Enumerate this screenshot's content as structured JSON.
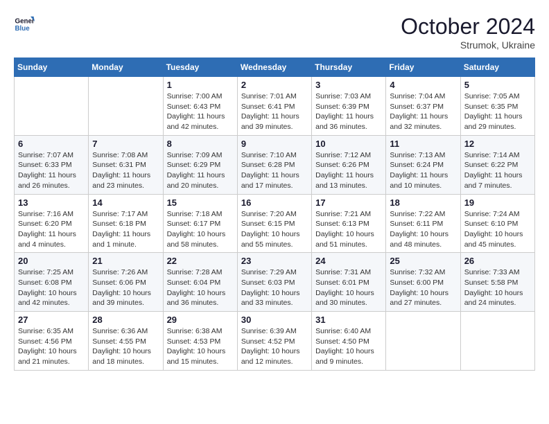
{
  "header": {
    "logo_line1": "General",
    "logo_line2": "Blue",
    "month": "October 2024",
    "location": "Strumok, Ukraine"
  },
  "weekdays": [
    "Sunday",
    "Monday",
    "Tuesday",
    "Wednesday",
    "Thursday",
    "Friday",
    "Saturday"
  ],
  "weeks": [
    [
      {
        "day": "",
        "info": ""
      },
      {
        "day": "",
        "info": ""
      },
      {
        "day": "1",
        "info": "Sunrise: 7:00 AM\nSunset: 6:43 PM\nDaylight: 11 hours and 42 minutes."
      },
      {
        "day": "2",
        "info": "Sunrise: 7:01 AM\nSunset: 6:41 PM\nDaylight: 11 hours and 39 minutes."
      },
      {
        "day": "3",
        "info": "Sunrise: 7:03 AM\nSunset: 6:39 PM\nDaylight: 11 hours and 36 minutes."
      },
      {
        "day": "4",
        "info": "Sunrise: 7:04 AM\nSunset: 6:37 PM\nDaylight: 11 hours and 32 minutes."
      },
      {
        "day": "5",
        "info": "Sunrise: 7:05 AM\nSunset: 6:35 PM\nDaylight: 11 hours and 29 minutes."
      }
    ],
    [
      {
        "day": "6",
        "info": "Sunrise: 7:07 AM\nSunset: 6:33 PM\nDaylight: 11 hours and 26 minutes."
      },
      {
        "day": "7",
        "info": "Sunrise: 7:08 AM\nSunset: 6:31 PM\nDaylight: 11 hours and 23 minutes."
      },
      {
        "day": "8",
        "info": "Sunrise: 7:09 AM\nSunset: 6:29 PM\nDaylight: 11 hours and 20 minutes."
      },
      {
        "day": "9",
        "info": "Sunrise: 7:10 AM\nSunset: 6:28 PM\nDaylight: 11 hours and 17 minutes."
      },
      {
        "day": "10",
        "info": "Sunrise: 7:12 AM\nSunset: 6:26 PM\nDaylight: 11 hours and 13 minutes."
      },
      {
        "day": "11",
        "info": "Sunrise: 7:13 AM\nSunset: 6:24 PM\nDaylight: 11 hours and 10 minutes."
      },
      {
        "day": "12",
        "info": "Sunrise: 7:14 AM\nSunset: 6:22 PM\nDaylight: 11 hours and 7 minutes."
      }
    ],
    [
      {
        "day": "13",
        "info": "Sunrise: 7:16 AM\nSunset: 6:20 PM\nDaylight: 11 hours and 4 minutes."
      },
      {
        "day": "14",
        "info": "Sunrise: 7:17 AM\nSunset: 6:18 PM\nDaylight: 11 hours and 1 minute."
      },
      {
        "day": "15",
        "info": "Sunrise: 7:18 AM\nSunset: 6:17 PM\nDaylight: 10 hours and 58 minutes."
      },
      {
        "day": "16",
        "info": "Sunrise: 7:20 AM\nSunset: 6:15 PM\nDaylight: 10 hours and 55 minutes."
      },
      {
        "day": "17",
        "info": "Sunrise: 7:21 AM\nSunset: 6:13 PM\nDaylight: 10 hours and 51 minutes."
      },
      {
        "day": "18",
        "info": "Sunrise: 7:22 AM\nSunset: 6:11 PM\nDaylight: 10 hours and 48 minutes."
      },
      {
        "day": "19",
        "info": "Sunrise: 7:24 AM\nSunset: 6:10 PM\nDaylight: 10 hours and 45 minutes."
      }
    ],
    [
      {
        "day": "20",
        "info": "Sunrise: 7:25 AM\nSunset: 6:08 PM\nDaylight: 10 hours and 42 minutes."
      },
      {
        "day": "21",
        "info": "Sunrise: 7:26 AM\nSunset: 6:06 PM\nDaylight: 10 hours and 39 minutes."
      },
      {
        "day": "22",
        "info": "Sunrise: 7:28 AM\nSunset: 6:04 PM\nDaylight: 10 hours and 36 minutes."
      },
      {
        "day": "23",
        "info": "Sunrise: 7:29 AM\nSunset: 6:03 PM\nDaylight: 10 hours and 33 minutes."
      },
      {
        "day": "24",
        "info": "Sunrise: 7:31 AM\nSunset: 6:01 PM\nDaylight: 10 hours and 30 minutes."
      },
      {
        "day": "25",
        "info": "Sunrise: 7:32 AM\nSunset: 6:00 PM\nDaylight: 10 hours and 27 minutes."
      },
      {
        "day": "26",
        "info": "Sunrise: 7:33 AM\nSunset: 5:58 PM\nDaylight: 10 hours and 24 minutes."
      }
    ],
    [
      {
        "day": "27",
        "info": "Sunrise: 6:35 AM\nSunset: 4:56 PM\nDaylight: 10 hours and 21 minutes."
      },
      {
        "day": "28",
        "info": "Sunrise: 6:36 AM\nSunset: 4:55 PM\nDaylight: 10 hours and 18 minutes."
      },
      {
        "day": "29",
        "info": "Sunrise: 6:38 AM\nSunset: 4:53 PM\nDaylight: 10 hours and 15 minutes."
      },
      {
        "day": "30",
        "info": "Sunrise: 6:39 AM\nSunset: 4:52 PM\nDaylight: 10 hours and 12 minutes."
      },
      {
        "day": "31",
        "info": "Sunrise: 6:40 AM\nSunset: 4:50 PM\nDaylight: 10 hours and 9 minutes."
      },
      {
        "day": "",
        "info": ""
      },
      {
        "day": "",
        "info": ""
      }
    ]
  ]
}
